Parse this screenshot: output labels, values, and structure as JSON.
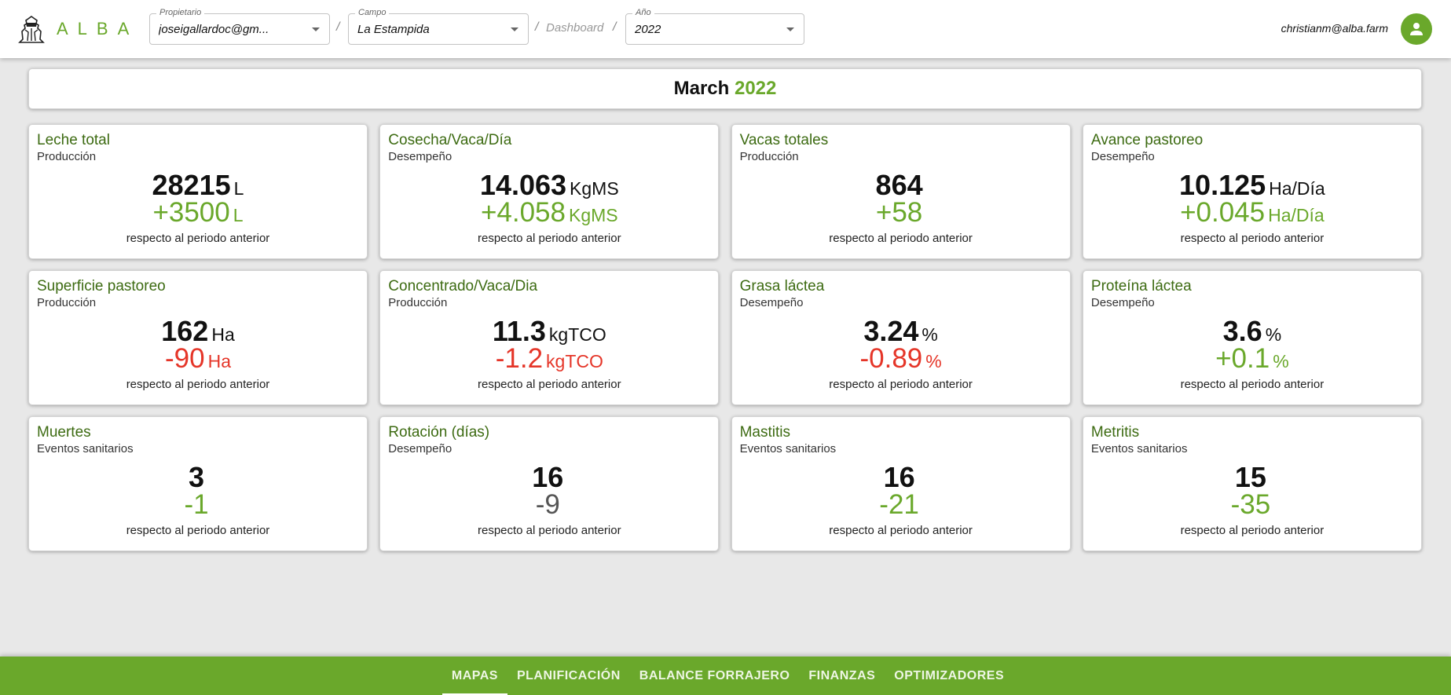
{
  "header": {
    "brand": "ALBA",
    "owner_field": {
      "label": "Propietario",
      "value": "joseigallardoc@gm..."
    },
    "farm_field": {
      "label": "Campo",
      "value": "La Estampida"
    },
    "breadcrumb_sep": "/",
    "breadcrumb_page": "Dashboard",
    "year_field": {
      "label": "Año",
      "value": "2022"
    },
    "user_email": "christianm@alba.farm"
  },
  "banner": {
    "month": "March",
    "year": "2022"
  },
  "colors": {
    "brand": "#6aa82b",
    "title": "#3d6b12",
    "positive": "#6aa82b",
    "negative": "#e53528",
    "neutral": "#555555"
  },
  "cards": [
    {
      "title": "Leche total",
      "category": "Producción",
      "value": "28215",
      "unit": "L",
      "delta": "+3500",
      "delta_unit": "L",
      "trend": "positive",
      "note": "respecto al periodo anterior"
    },
    {
      "title": "Cosecha/Vaca/Día",
      "category": "Desempeño",
      "value": "14.063",
      "unit": "KgMS",
      "delta": "+4.058",
      "delta_unit": "KgMS",
      "trend": "positive",
      "note": "respecto al periodo anterior"
    },
    {
      "title": "Vacas totales",
      "category": "Producción",
      "value": "864",
      "unit": "",
      "delta": "+58",
      "delta_unit": "",
      "trend": "positive",
      "note": "respecto al periodo anterior"
    },
    {
      "title": "Avance pastoreo",
      "category": "Desempeño",
      "value": "10.125",
      "unit": "Ha/Día",
      "delta": "+0.045",
      "delta_unit": "Ha/Día",
      "trend": "positive",
      "note": "respecto al periodo anterior"
    },
    {
      "title": "Superficie pastoreo",
      "category": "Producción",
      "value": "162",
      "unit": "Ha",
      "delta": "-90",
      "delta_unit": "Ha",
      "trend": "negative",
      "note": "respecto al periodo anterior"
    },
    {
      "title": "Concentrado/Vaca/Dia",
      "category": "Producción",
      "value": "11.3",
      "unit": "kgTCO",
      "delta": "-1.2",
      "delta_unit": "kgTCO",
      "trend": "negative",
      "note": "respecto al periodo anterior"
    },
    {
      "title": "Grasa láctea",
      "category": "Desempeño",
      "value": "3.24",
      "unit": "%",
      "delta": "-0.89",
      "delta_unit": "%",
      "trend": "negative",
      "note": "respecto al periodo anterior"
    },
    {
      "title": "Proteína láctea",
      "category": "Desempeño",
      "value": "3.6",
      "unit": "%",
      "delta": "+0.1",
      "delta_unit": "%",
      "trend": "positive",
      "note": "respecto al periodo anterior"
    },
    {
      "title": "Muertes",
      "category": "Eventos sanitarios",
      "value": "3",
      "unit": "",
      "delta": "-1",
      "delta_unit": "",
      "trend": "positive",
      "note": "respecto al periodo anterior"
    },
    {
      "title": "Rotación (días)",
      "category": "Desempeño",
      "value": "16",
      "unit": "",
      "delta": "-9",
      "delta_unit": "",
      "trend": "neutral",
      "note": "respecto al periodo anterior"
    },
    {
      "title": "Mastitis",
      "category": "Eventos sanitarios",
      "value": "16",
      "unit": "",
      "delta": "-21",
      "delta_unit": "",
      "trend": "positive",
      "note": "respecto al periodo anterior"
    },
    {
      "title": "Metritis",
      "category": "Eventos sanitarios",
      "value": "15",
      "unit": "",
      "delta": "-35",
      "delta_unit": "",
      "trend": "positive",
      "note": "respecto al periodo anterior"
    }
  ],
  "bottom_nav": {
    "active": "MAPAS",
    "items": [
      "MAPAS",
      "PLANIFICACIÓN",
      "BALANCE FORRAJERO",
      "FINANZAS",
      "OPTIMIZADORES"
    ]
  }
}
